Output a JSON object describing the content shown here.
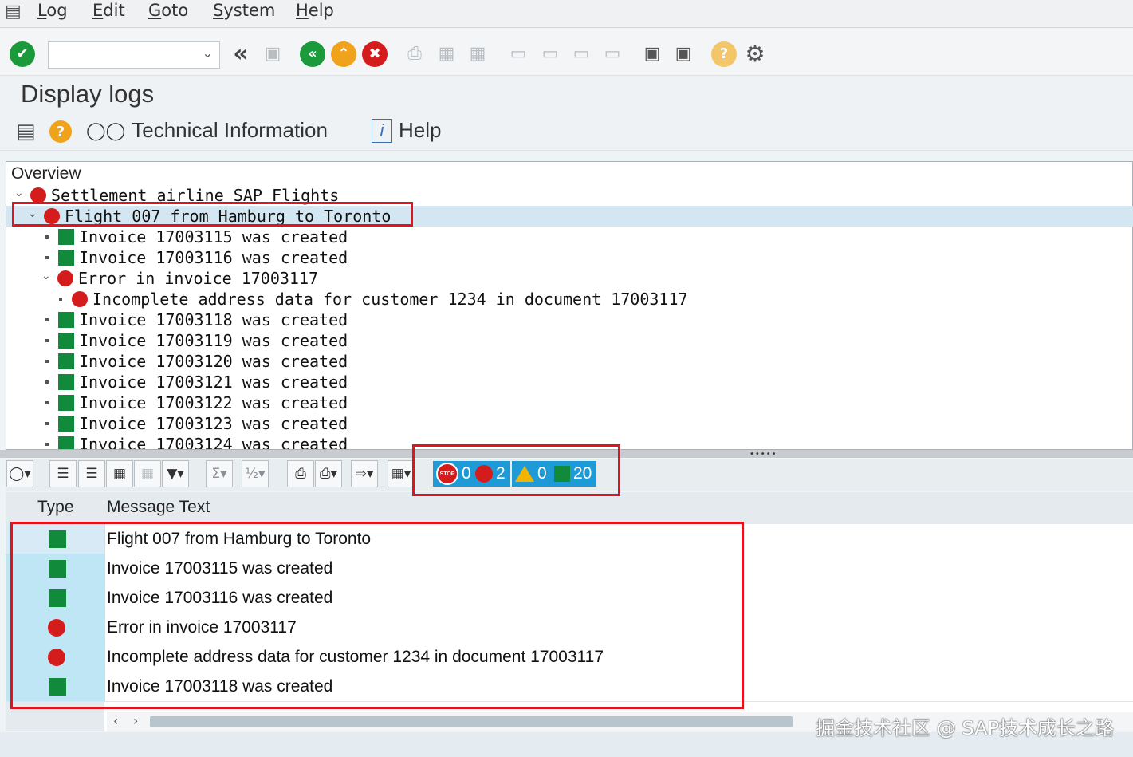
{
  "menu": {
    "items": [
      "Log",
      "Edit",
      "Goto",
      "System",
      "Help"
    ]
  },
  "toolbar": {
    "command_field_value": "",
    "icons": [
      "enter-icon",
      "back-icon",
      "save-icon",
      "back-green-icon",
      "exit-icon",
      "cancel-icon",
      "print-icon",
      "find-icon",
      "find-next-icon",
      "first-page-icon",
      "previous-page-icon",
      "next-page-icon",
      "last-page-icon",
      "create-session-icon",
      "shortcut-icon",
      "help-icon",
      "settings-icon"
    ]
  },
  "page": {
    "title": "Display logs"
  },
  "app_toolbar": {
    "technical_information": "Technical Information",
    "help": "Help"
  },
  "overview": {
    "header": "Overview",
    "nodes": [
      {
        "text": "Settlement airline SAP Flights",
        "status": "error"
      },
      {
        "text": "Flight 007 from Hamburg to Toronto",
        "status": "error"
      },
      {
        "text": "Invoice 17003115 was created",
        "status": "success"
      },
      {
        "text": "Invoice 17003116 was created",
        "status": "success"
      },
      {
        "text": "Error in invoice 17003117",
        "status": "error"
      },
      {
        "text": "Incomplete address data for customer 1234 in document 17003117",
        "status": "error"
      },
      {
        "text": "Invoice 17003118 was created",
        "status": "success"
      },
      {
        "text": "Invoice 17003119 was created",
        "status": "success"
      },
      {
        "text": "Invoice 17003120 was created",
        "status": "success"
      },
      {
        "text": "Invoice 17003121 was created",
        "status": "success"
      },
      {
        "text": "Invoice 17003122 was created",
        "status": "success"
      },
      {
        "text": "Invoice 17003123 was created",
        "status": "success"
      },
      {
        "text": "Invoice 17003124 was created",
        "status": "success"
      }
    ]
  },
  "counts": {
    "abort": "0",
    "error": "2",
    "warning": "0",
    "success": "20",
    "stop_label": "STOP"
  },
  "table": {
    "columns": [
      "Type",
      "Message Text"
    ],
    "rows": [
      {
        "type": "success",
        "text": "Flight 007 from Hamburg to Toronto"
      },
      {
        "type": "success",
        "text": "Invoice 17003115 was created"
      },
      {
        "type": "success",
        "text": "Invoice 17003116 was created"
      },
      {
        "type": "error",
        "text": "Error in invoice 17003117"
      },
      {
        "type": "error",
        "text": "Incomplete address data for customer 1234 in document 17003117"
      },
      {
        "type": "success",
        "text": "Invoice 17003118 was created"
      }
    ]
  },
  "watermark": "掘金技术社区 @ SAP技术成长之路",
  "colors": {
    "error": "#d51c1c",
    "success": "#118a3c",
    "accent": "#1e9bd7",
    "annotation": "#e0141e"
  }
}
